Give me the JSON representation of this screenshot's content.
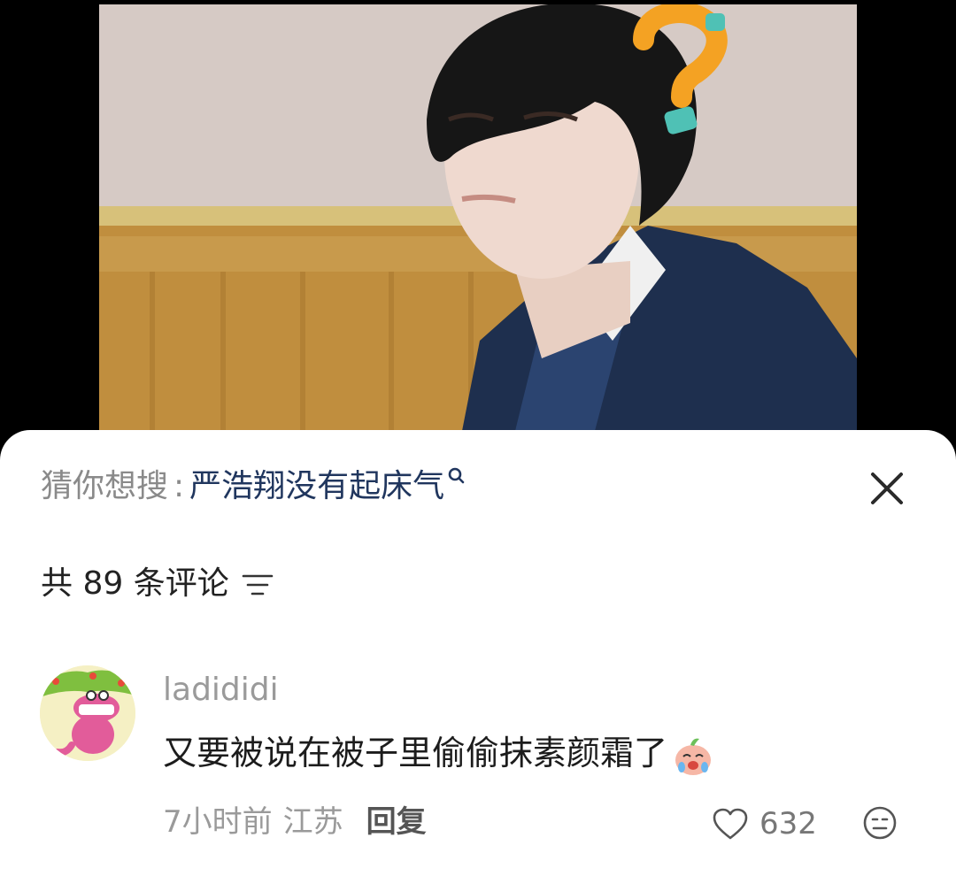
{
  "search_suggestion": {
    "prefix": "猜你想搜",
    "separator": ":",
    "query": "严浩翔没有起床气",
    "search_icon": "search-icon",
    "close_icon": "close-icon"
  },
  "comments_header": {
    "count_label": "共 89 条评论",
    "sort_icon": "sort-filter-icon"
  },
  "comment": {
    "username": "ladididi",
    "text": "又要被说在被子里偷偷抹素颜霜了",
    "sticker": "crying-peach-sticker",
    "time": "7小时前",
    "location": "江苏",
    "reply_label": "回复",
    "like_count": "632",
    "like_icon": "heart-outline-icon",
    "react_icon": "emoji-face-icon"
  },
  "colors": {
    "query": "#20365e",
    "muted": "#9a9a9a",
    "text": "#1c1c1c",
    "sheet": "#ffffff",
    "background": "#000000"
  }
}
